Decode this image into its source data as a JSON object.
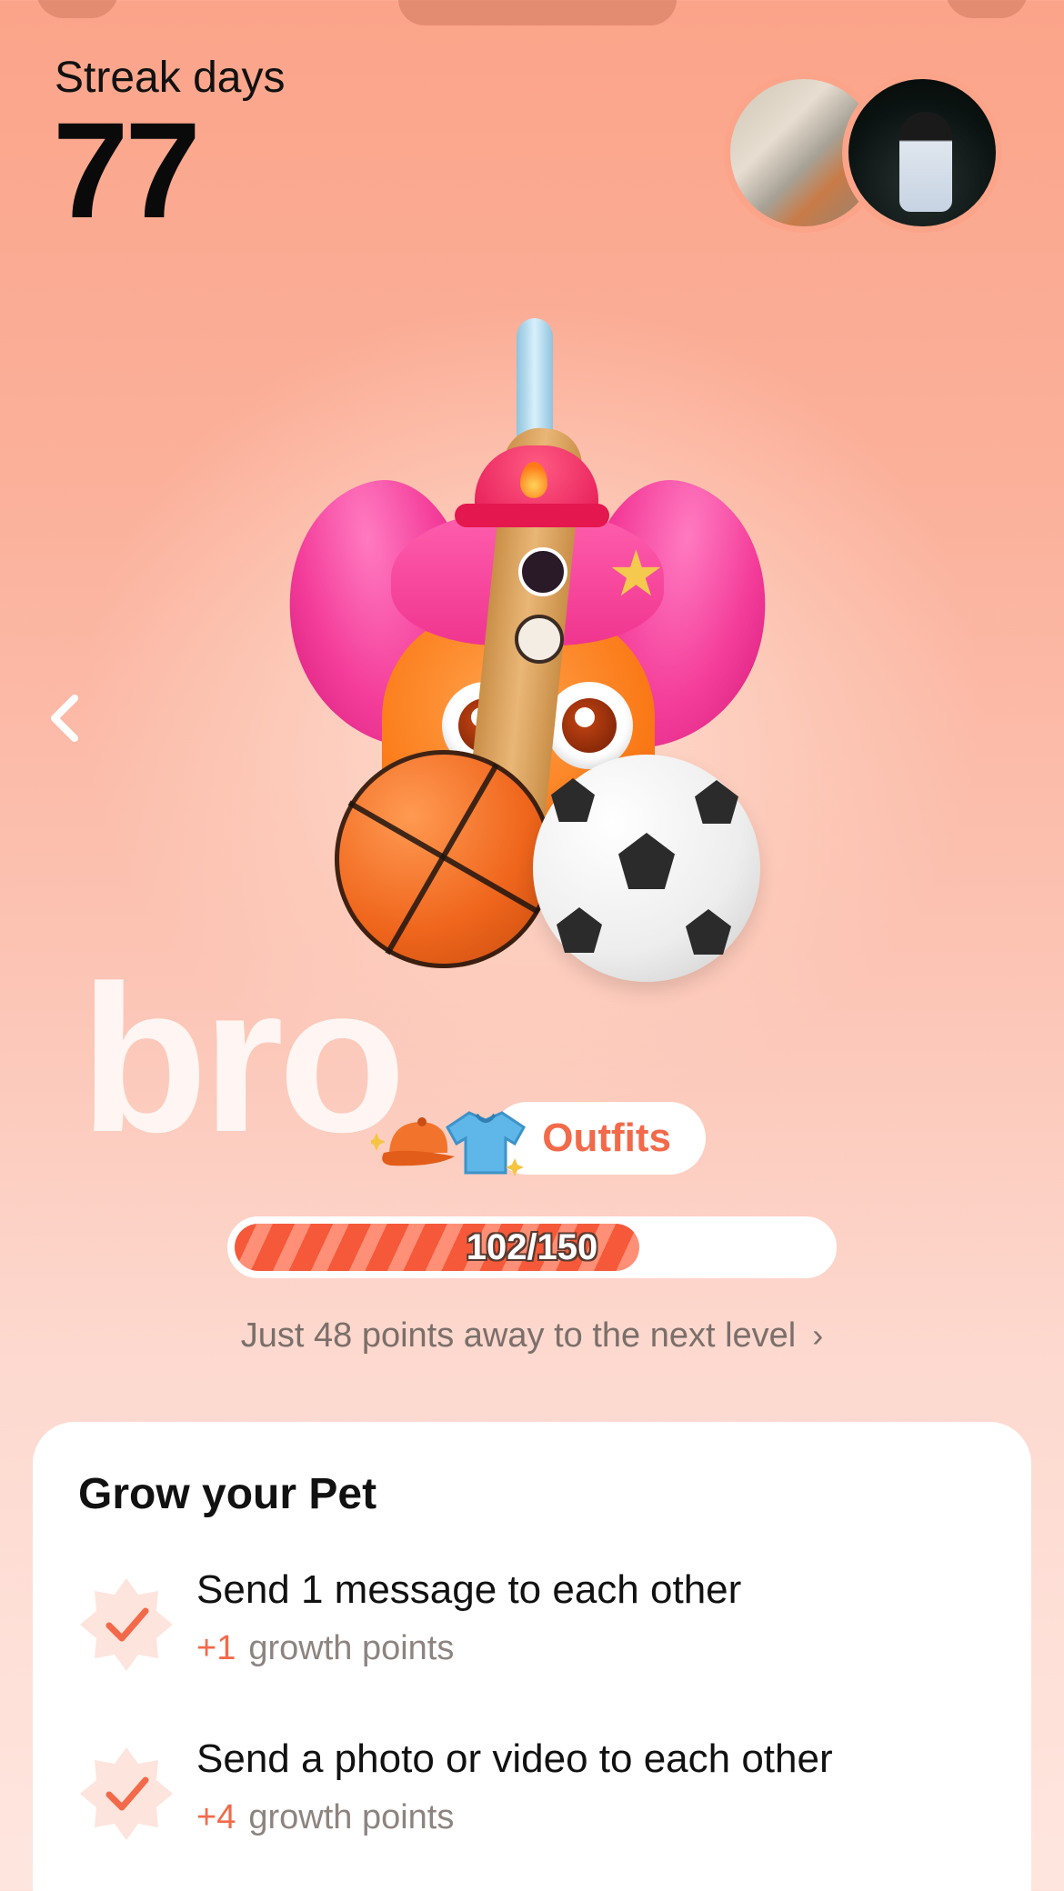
{
  "streak": {
    "label": "Streak days",
    "value": "77"
  },
  "pet": {
    "name": "bro"
  },
  "outfits_label": "Outfits",
  "progress": {
    "current": 102,
    "max": 150,
    "text": "102/150",
    "fill_fraction": 0.68
  },
  "next_level_text": "Just 48 points away to the next level",
  "grow_card": {
    "title": "Grow your Pet",
    "tasks": [
      {
        "title": "Send 1 message to each other",
        "points": "+1",
        "suffix": "growth points",
        "done": true
      },
      {
        "title": "Send a photo or video to each other",
        "points": "+4",
        "suffix": "growth points",
        "done": true
      }
    ]
  },
  "colors": {
    "accent": "#f26a4a",
    "background_top": "#fba48a",
    "background_bottom": "#fee6df"
  },
  "icons": [
    "chevron-left-icon",
    "cap-icon",
    "shirt-icon",
    "chevron-right-icon",
    "check-badge-icon"
  ]
}
